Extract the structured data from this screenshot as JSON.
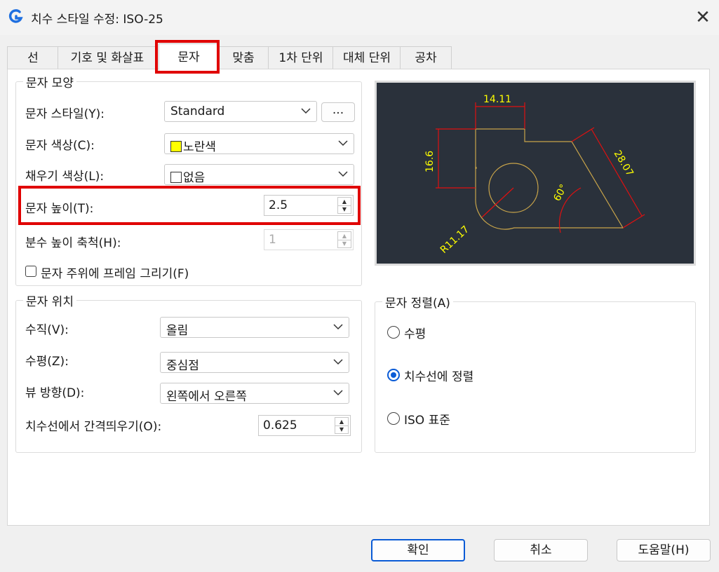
{
  "window": {
    "title": "치수 스타일 수정: ISO-25"
  },
  "tabs": [
    "선",
    "기호 및 화살표",
    "문자",
    "맞춤",
    "1차 단위",
    "대체 단위",
    "공차"
  ],
  "text_appearance": {
    "title": "문자 모양",
    "style_label": "문자 스타일(Y):",
    "style_value": "Standard",
    "style_browse": "...",
    "color_label": "문자 색상(C):",
    "color_value": "노란색",
    "fill_label": "채우기 색상(L):",
    "fill_value": "없음",
    "height_label": "문자 높이(T):",
    "height_value": "2.5",
    "fraction_label": "분수 높이 축척(H):",
    "fraction_value": "1",
    "frame_label": "문자 주위에 프레임 그리기(F)"
  },
  "text_placement": {
    "title": "문자 위치",
    "vertical_label": "수직(V):",
    "vertical_value": "올림",
    "horizontal_label": "수평(Z):",
    "horizontal_value": "중심점",
    "view_label": "뷰 방향(D):",
    "view_value": "왼쪽에서 오른쪽",
    "offset_label": "치수선에서 간격띄우기(O):",
    "offset_value": "0.625"
  },
  "text_alignment": {
    "title": "문자 정렬(A)",
    "options": [
      "수평",
      "치수선에 정렬",
      "ISO 표준"
    ],
    "selected": "치수선에 정렬"
  },
  "preview": {
    "dim_top": "14.11",
    "dim_left": "16.6",
    "dim_diag": "28.07",
    "dim_angle": "60°",
    "dim_radius": "R11.17"
  },
  "buttons": {
    "ok": "확인",
    "cancel": "취소",
    "help": "도움말(H)"
  },
  "colors": {
    "text_color": "#ffff00",
    "accent": "#0a5bd6",
    "highlight": "#e00000"
  }
}
